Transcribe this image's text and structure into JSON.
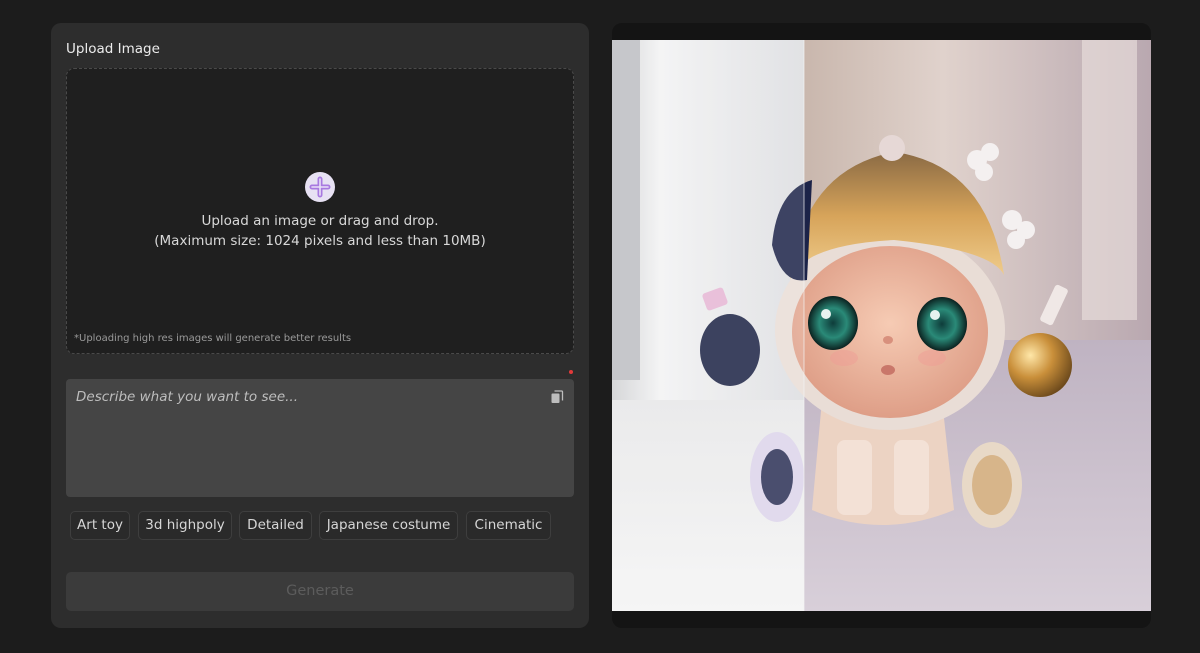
{
  "upload": {
    "title": "Upload Image",
    "drop_line1": "Upload an image or drag and drop.",
    "drop_line2": "(Maximum size: 1024 pixels and less than 10MB)",
    "hint": "*Uploading high res images will generate better results",
    "plus_icon": "plus-icon"
  },
  "prompt": {
    "placeholder": "Describe what you want to see...",
    "copy_icon": "copy-icon"
  },
  "tags": [
    "Art toy",
    "3d highpoly",
    "Detailed",
    "Japanese costume",
    "Cinematic"
  ],
  "generate": {
    "label": "Generate"
  },
  "colors": {
    "page_bg": "#1c1c1c",
    "panel_bg": "#2d2d2d",
    "accent_purple": "#9b6fd6",
    "required_dot": "#e23a3a"
  }
}
